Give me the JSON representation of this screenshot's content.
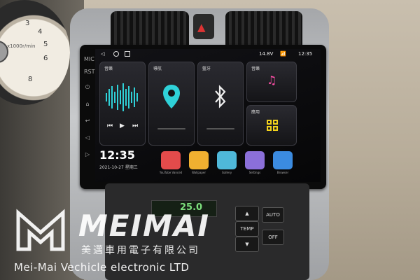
{
  "gauge": {
    "label": "x1000r/min",
    "numbers": [
      "3",
      "4",
      "5",
      "6",
      "8"
    ]
  },
  "hazard_symbol": "▲",
  "head_unit": {
    "side_labels": [
      "MIC",
      "RST",
      "⏻",
      "⌂",
      "↩",
      "◁",
      "▷"
    ],
    "status": {
      "nav_back": "◁",
      "battery": "14.8V",
      "time": "12:35"
    },
    "cards": {
      "music": {
        "title": "音樂"
      },
      "nav": {
        "title": "導航"
      },
      "bluetooth": {
        "title": "藍牙"
      },
      "audio": {
        "title": "音樂"
      },
      "apps": {
        "title": "應用"
      }
    },
    "clock": "12:35",
    "date": "2021-10-27      星期三",
    "apps": [
      {
        "label": "YouTube Vanced",
        "color": "#e34b4b"
      },
      {
        "label": "Wallpaper",
        "color": "#f0b030"
      },
      {
        "label": "Gallery",
        "color": "#4fb8d9"
      },
      {
        "label": "Settings",
        "color": "#8b6fd9"
      },
      {
        "label": "Browser",
        "color": "#3b8be0"
      }
    ]
  },
  "climate": {
    "temperature": "25.0",
    "buttons": {
      "temp": "TEMP",
      "auto": "AUTO",
      "off": "OFF",
      "up": "▲",
      "down": "▼"
    }
  },
  "watermark": {
    "brand": "MEIMAI",
    "chinese": "美邁車用電子有限公司",
    "english": "Mei-Mai Vechicle electronic LTD"
  },
  "colors": {
    "accent": "#2fd1d8",
    "music_pink": "#ff4fa8",
    "apps_yellow": "#f2d21c"
  }
}
